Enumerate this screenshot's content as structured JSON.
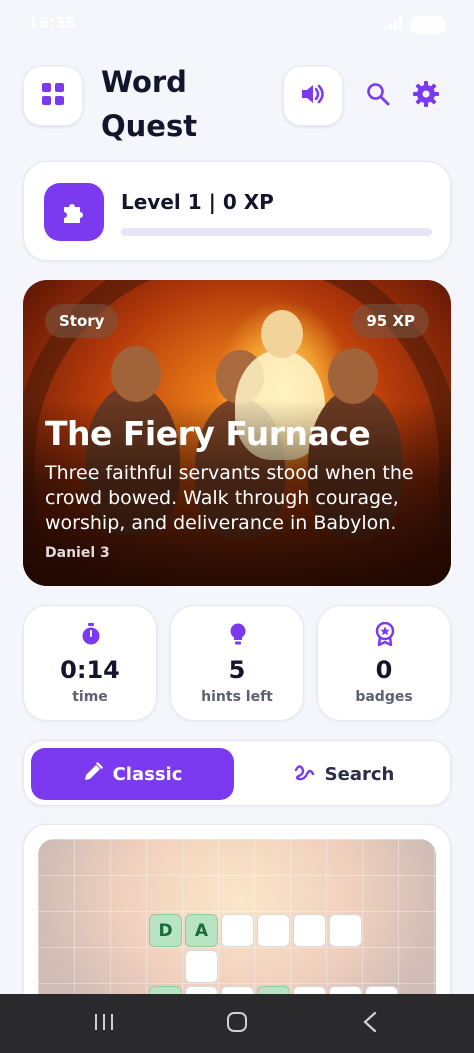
{
  "status_bar": {
    "time": "16:35"
  },
  "header": {
    "app_title": "Word Quest",
    "icons": {
      "menu": "grid-icon",
      "sound": "volume-icon",
      "search": "search-icon",
      "settings": "gear-icon"
    }
  },
  "level": {
    "label": "Level 1 | 0 XP",
    "icon": "puzzle-icon",
    "progress": 0
  },
  "story": {
    "type": "Story",
    "xp": "95 XP",
    "title": "The Fiery Furnace",
    "description": "Three faithful servants stood when the crowd bowed. Walk through courage, worship, and deliverance in Babylon.",
    "reference": "Daniel 3"
  },
  "stats": [
    {
      "value": "0:14",
      "label": "time",
      "icon": "stopwatch-icon"
    },
    {
      "value": "5",
      "label": "hints left",
      "icon": "lightbulb-icon"
    },
    {
      "value": "0",
      "label": "badges",
      "icon": "badge-icon"
    }
  ],
  "modes": {
    "classic": "Classic",
    "search": "Search",
    "active": "Classic"
  },
  "puzzle": {
    "row1": [
      "D",
      "A",
      "",
      "",
      "",
      ""
    ]
  },
  "colors": {
    "accent": "#7b3af0",
    "background": "#f5f6fb",
    "filled_cell": "#b9e4c4"
  }
}
